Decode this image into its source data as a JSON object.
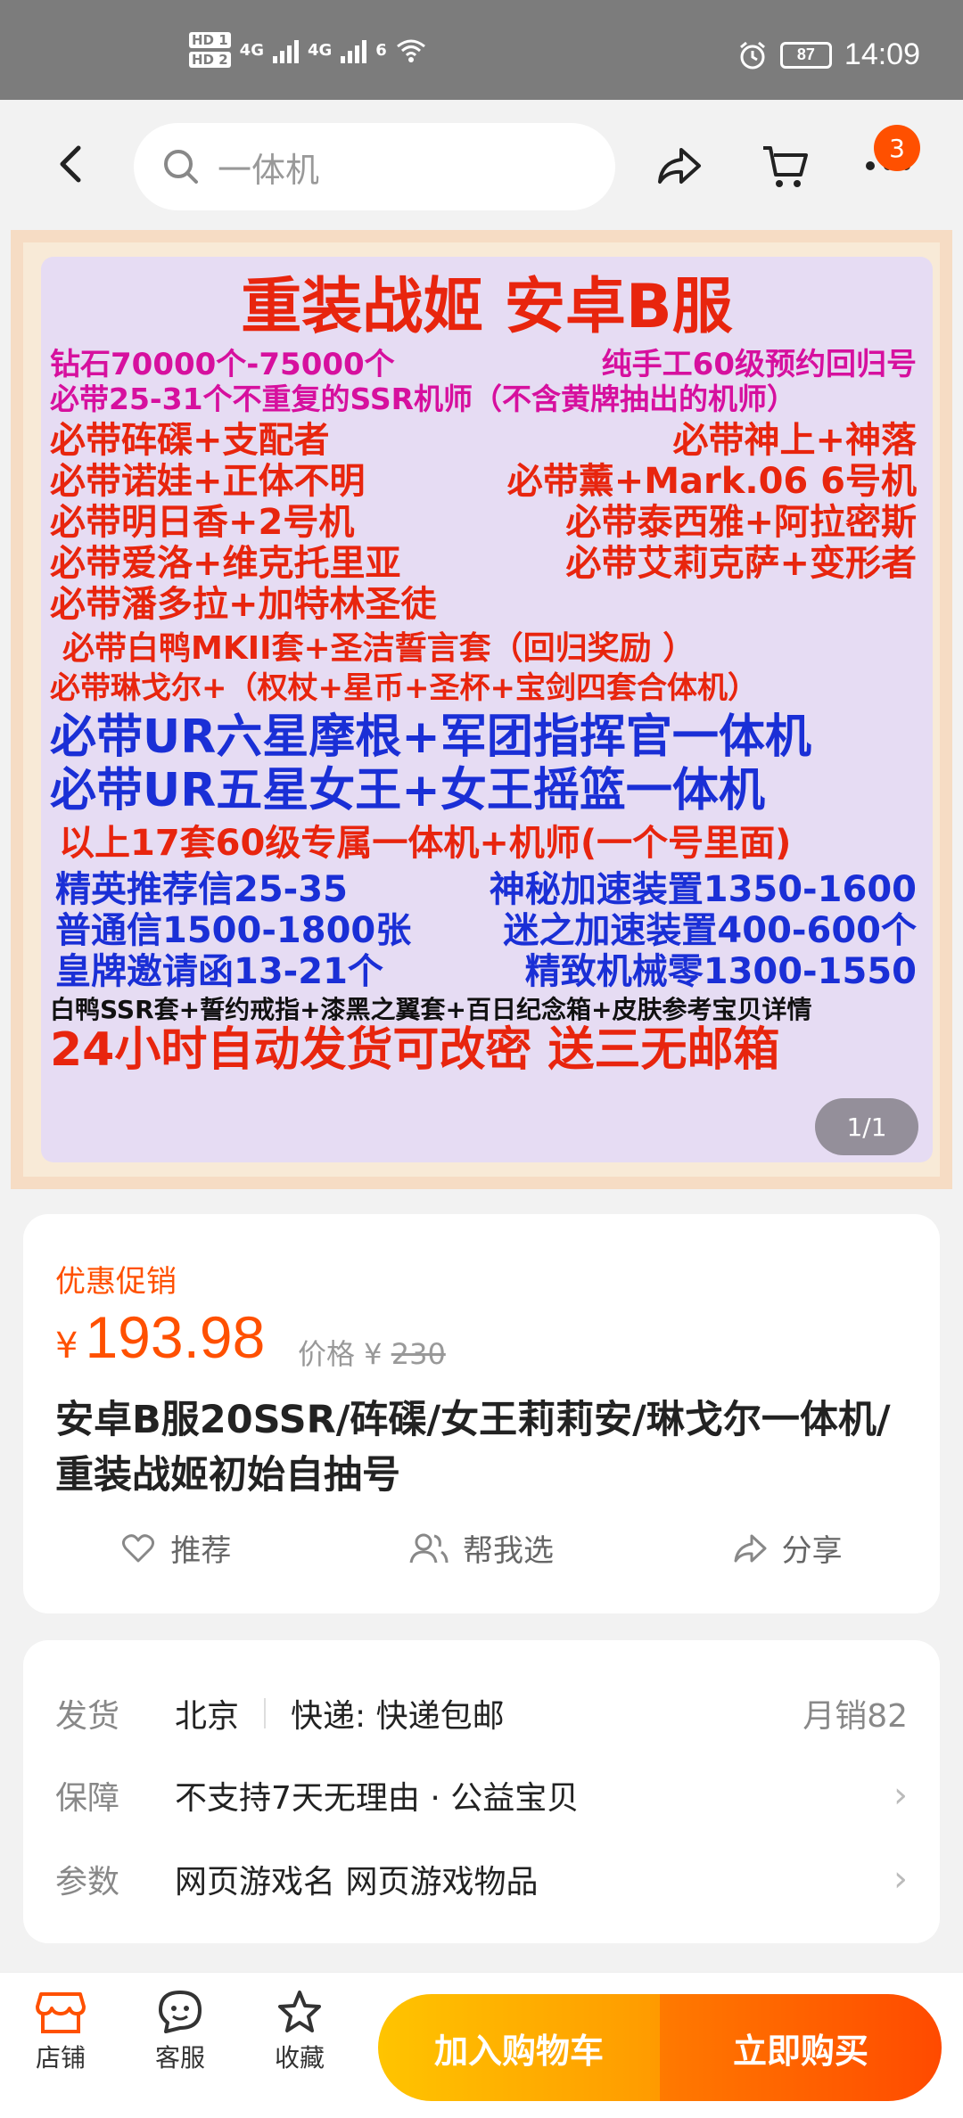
{
  "status_bar": {
    "hd1": "HD 1",
    "hd2": "HD 2",
    "net1": "4G",
    "net2": "4G",
    "wifi_label": "6",
    "battery": "87",
    "time": "14:09"
  },
  "nav": {
    "search_placeholder": "一体机",
    "cart_badge": "3"
  },
  "hero": {
    "title": "重装战姬   安卓B服",
    "lines": [
      {
        "left": "钻石70000个-75000个",
        "right": "纯手工60级预约回归号"
      },
      {
        "text": "必带25-31个不重复的SSR机师（不含黄牌抽出的机师）"
      },
      {
        "left": "必带砗磲+支配者",
        "right": "必带神上+神落"
      },
      {
        "left": "必带诺娃+正体不明",
        "right": "必带薰+Mark.06 6号机"
      },
      {
        "left": "必带明日香+2号机",
        "right": "必带泰西雅+阿拉密斯"
      },
      {
        "left": "必带爱洛+维克托里亚",
        "right": "必带艾莉克萨+变形者"
      },
      {
        "text": "必带潘多拉+加特林圣徒"
      },
      {
        "text": "必带白鸭MKII套+圣洁誓言套（回归奖励 ）"
      },
      {
        "text": "必带琳戈尔+（权杖+星币+圣杯+宝剑四套合体机）"
      },
      {
        "text": "必带UR六星摩根+军团指挥官一体机"
      },
      {
        "text": "必带UR五星女王+女王摇篮一体机"
      },
      {
        "text": "以上17套60级专属一体机+机师(一个号里面)"
      },
      {
        "left": "精英推荐信25-35",
        "right": "神秘加速装置1350-1600"
      },
      {
        "left": "普通信1500-1800张",
        "right": "迷之加速装置400-600个"
      },
      {
        "left": "皇牌邀请函13-21个",
        "right": "精致机械零1300-1550"
      },
      {
        "text": "白鸭SSR套+誓约戒指+漆黑之翼套+百日纪念箱+皮肤参考宝贝详情"
      },
      {
        "text": "24小时自动发货可改密  送三无邮箱"
      }
    ],
    "pager": "1/1"
  },
  "product": {
    "promo_label": "优惠促销",
    "currency": "¥",
    "price": "193.98",
    "orig_label": "价格 ¥",
    "orig_price": "230",
    "title": "安卓B服20SSR/砗磲/女王莉莉安/琳戈尔一体机/重装战姬初始自抽号",
    "actions": {
      "recommend": "推荐",
      "help_choose": "帮我选",
      "share": "分享"
    }
  },
  "info": {
    "ship_key": "发货",
    "ship_city": "北京",
    "ship_express": "快递: 快递包邮",
    "monthly_sales": "月销82",
    "guarantee_key": "保障",
    "guarantee_val": "不支持7天无理由 · 公益宝贝",
    "params_key": "参数",
    "params_val": "网页游戏名 网页游戏物品"
  },
  "bottom": {
    "shop": "店铺",
    "service": "客服",
    "favorite": "收藏",
    "add_cart": "加入购物车",
    "buy_now": "立即购买"
  },
  "colors": {
    "accent": "#ff5000",
    "cart_btn": "#ffb300",
    "buy_btn": "#ff5a00"
  }
}
